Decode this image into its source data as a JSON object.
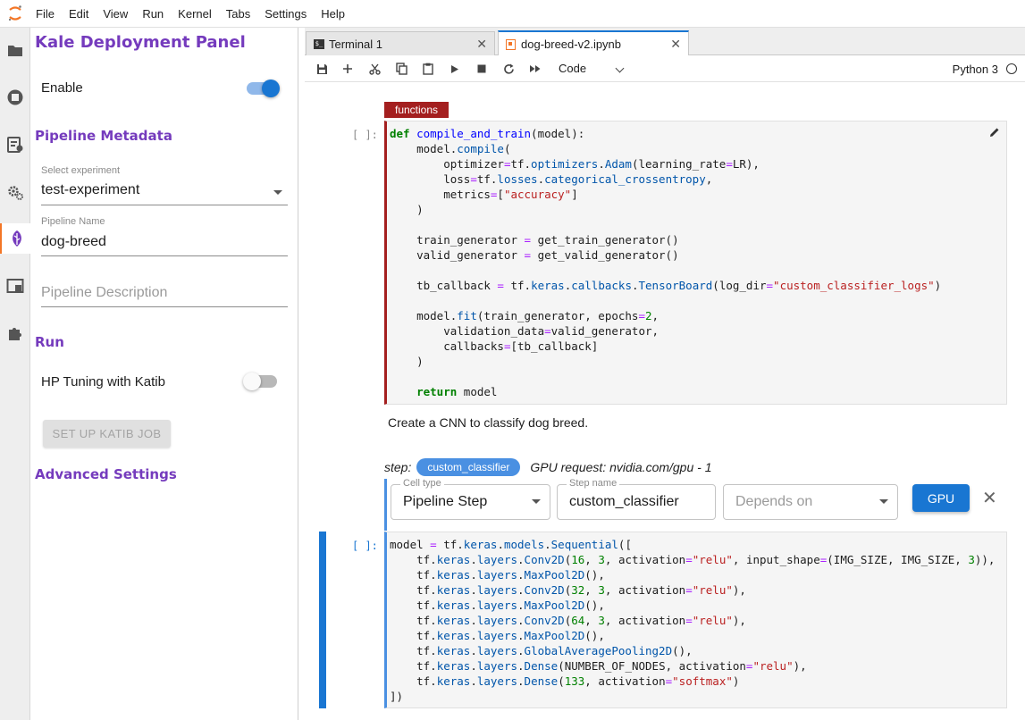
{
  "menubar": {
    "items": [
      "File",
      "Edit",
      "View",
      "Run",
      "Kernel",
      "Tabs",
      "Settings",
      "Help"
    ]
  },
  "activity_icons": [
    "folder-icon",
    "running-icon",
    "commands-icon",
    "property-inspector-icon",
    "kale-icon",
    "tabs-icon",
    "extensions-icon"
  ],
  "kale_panel": {
    "title": "Kale Deployment Panel",
    "enable_label": "Enable",
    "enable_on": true,
    "metadata_heading": "Pipeline Metadata",
    "experiment_label": "Select experiment",
    "experiment_value": "test-experiment",
    "pipeline_name_label": "Pipeline Name",
    "pipeline_name_value": "dog-breed",
    "pipeline_description_placeholder": "Pipeline Description",
    "run_heading": "Run",
    "hp_tuning_label": "HP Tuning with Katib",
    "hp_tuning_on": false,
    "katib_button": "SET UP KATIB JOB",
    "advanced_heading": "Advanced Settings",
    "accent_color": "#753bbd"
  },
  "tabs": [
    {
      "label": "Terminal 1",
      "icon": "terminal-icon",
      "active": false
    },
    {
      "label": "dog-breed-v2.ipynb",
      "icon": "notebook-icon",
      "active": true
    }
  ],
  "toolbar": {
    "cell_type": "Code",
    "kernel": "Python 3"
  },
  "notebook": {
    "cell1": {
      "tag": "functions",
      "prompt": "[ ]:"
    },
    "markdown": "Create a CNN to classify dog breed.",
    "step": {
      "label": "step:",
      "name": "custom_classifier",
      "gpu_request": "GPU request: nvidia.com/gpu - 1"
    },
    "controls": {
      "cell_type_legend": "Cell type",
      "cell_type_value": "Pipeline Step",
      "step_name_legend": "Step name",
      "step_name_value": "custom_classifier",
      "depends_on_placeholder": "Depends on",
      "gpu_button": "GPU"
    },
    "cell2": {
      "prompt": "[ ]:"
    }
  },
  "colors": {
    "functions_tag": "#a41f1f",
    "step_chip": "#4a90e2",
    "gpu_button": "#1976d2",
    "jupyter_orange": "#f37626"
  }
}
